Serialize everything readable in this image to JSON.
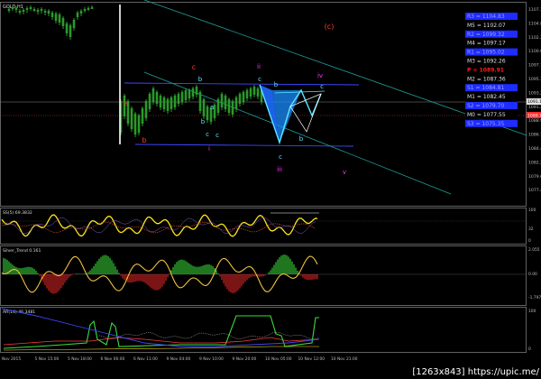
{
  "symbol_label": "GOLD,H1",
  "price_axis": [
    "1107.14",
    "1104.89",
    "1102.28",
    "1100.03",
    "1097.78",
    "1095.17",
    "1093.28",
    "1091.29",
    "1088.99",
    "1086.74",
    "1084.44",
    "1082.24",
    "1079.64",
    "1077.45"
  ],
  "current_price": "1091.14",
  "red_price_tag": "1089.76",
  "levels": [
    {
      "text": "R3 = 1104.83",
      "color": "#1e2cff"
    },
    {
      "text": "M5 = 1102.07",
      "color": "#e0e0e0"
    },
    {
      "text": "R2 = 1099.32",
      "color": "#1e2cff"
    },
    {
      "text": "M4 = 1097.17",
      "color": "#e0e0e0"
    },
    {
      "text": "R1 = 1095.02",
      "color": "#1e2cff"
    },
    {
      "text": "M3 = 1092.26",
      "color": "#e0e0e0"
    },
    {
      "text": "P = 1089.91",
      "color": "#ff2020"
    },
    {
      "text": "M2 = 1087.36",
      "color": "#e0e0e0"
    },
    {
      "text": "S1 = 1084.81",
      "color": "#1e2cff"
    },
    {
      "text": "M1 = 1082.45",
      "color": "#e0e0e0"
    },
    {
      "text": "S2 = 1079.70",
      "color": "#1e2cff"
    },
    {
      "text": "M0 = 1077.55",
      "color": "#e0e0e0"
    },
    {
      "text": "S3 = 1075.35",
      "color": "#1e2cff"
    }
  ],
  "wave_labels": {
    "a_red": "a",
    "b_red": "b",
    "c_red": "c",
    "c_paren": "(c)",
    "ii": "ii",
    "iii": "iii",
    "iv": "iv",
    "v": "v",
    "i": "i",
    "a_cyan": "a",
    "b_cyan1": "b",
    "b_cyan2": "b",
    "c_cyan1": "c",
    "c_cyan2": "c",
    "c_cyan3": "c",
    "c_cyan4": "c",
    "b_cyan3": "b"
  },
  "panel1": {
    "label": "SS(5) 69.3832",
    "axis": [
      "100",
      "32",
      "0"
    ]
  },
  "panel2": {
    "label": "Silver_Trend 0.161",
    "axis": [
      "2.055",
      "0.00",
      "-1.797"
    ]
  },
  "panel3": {
    "label": "AR(14) 46.3481",
    "axis": [
      "100",
      "0"
    ]
  },
  "time_axis": [
    "Nov 2015",
    "5 Nov 15:00",
    "5 Nov 18:00",
    "6 Nov 06:00",
    "6 Nov 11:00",
    "9 Nov 04:00",
    "9 Nov 10:00",
    "9 Nov 20:00",
    "10 Nov 05:00",
    "10 Nov 12:00",
    "10 Nov 21:00"
  ],
  "watermark": "[1263x843] https://upic.me/"
}
